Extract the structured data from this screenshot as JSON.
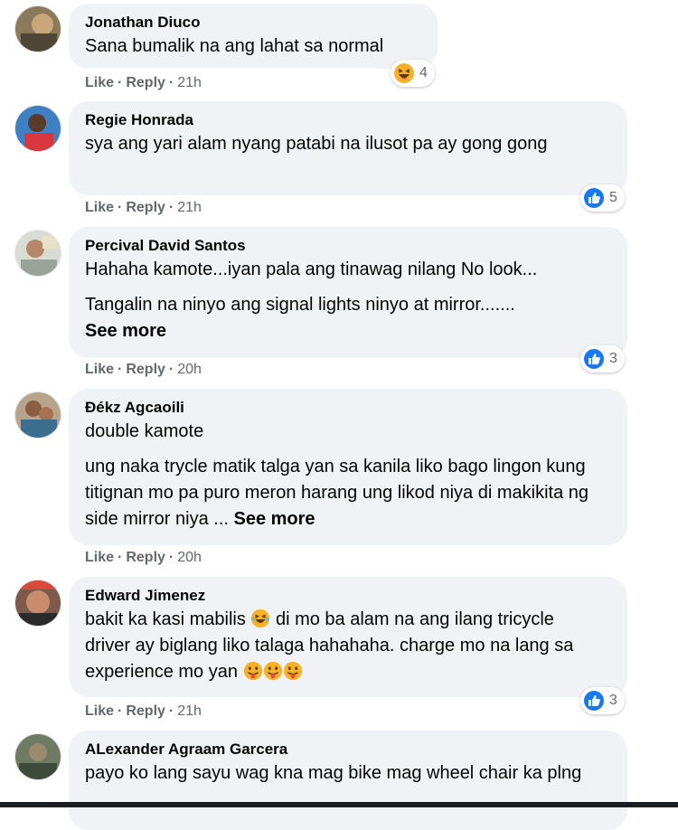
{
  "colors": {
    "bubble": "#f0f2f5",
    "meta": "#65676b",
    "like_blue": "#1877f2",
    "haha_yellow": "#f7b125"
  },
  "actions": {
    "like": "Like",
    "reply": "Reply",
    "separator": "·"
  },
  "comments": [
    {
      "author": "Jonathan Diuco",
      "paragraphs": [
        "Sana bumalik na ang lahat sa normal"
      ],
      "time": "21h",
      "reaction": {
        "icon": "haha-emoji-icon",
        "count": "4"
      }
    },
    {
      "author": "Regie Honrada",
      "paragraphs": [
        "sya ang yari alam nyang patabi na ilusot pa ay gong gong"
      ],
      "time": "21h",
      "reaction": {
        "icon": "like-icon",
        "count": "5"
      }
    },
    {
      "author": "Percival David Santos",
      "paragraphs": [
        "Hahaha kamote...iyan pala ang tinawag nilang No look...",
        "Tangalin na ninyo ang signal lights ninyo at mirror......."
      ],
      "see_more": "See more",
      "time": "20h",
      "reaction": {
        "icon": "like-icon",
        "count": "3"
      }
    },
    {
      "author": "Đékz Agcaoili",
      "paragraphs": [
        "double kamote",
        "ung naka trycle matik talga yan sa kanila liko bago lingon kung titignan mo pa puro meron harang ung likod niya di makikita ng side mirror niya ..."
      ],
      "see_more": "See more",
      "time": "20h"
    },
    {
      "author": "Edward Jimenez",
      "text_before_emoji": "bakit ka kasi mabilis",
      "text_after_emoji": "di mo ba alam na ang ilang tricycle driver ay biglang liko talaga hahahaha. charge mo na lang sa experience mo yan",
      "time": "21h",
      "reaction": {
        "icon": "like-icon",
        "count": "3"
      }
    },
    {
      "author": "ALexander Agraam Garcera",
      "paragraphs": [
        "payo ko lang sayu wag kna mag bike mag wheel chair ka plng"
      ]
    }
  ]
}
